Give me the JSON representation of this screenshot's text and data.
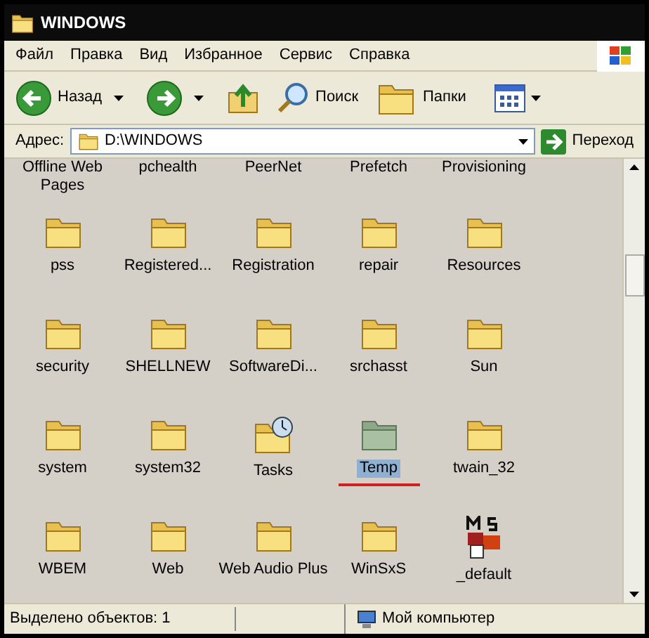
{
  "window": {
    "title": "WINDOWS"
  },
  "menu": [
    "Файл",
    "Правка",
    "Вид",
    "Избранное",
    "Сервис",
    "Справка"
  ],
  "toolbar": {
    "back": "Назад",
    "search": "Поиск",
    "folders": "Папки"
  },
  "address": {
    "label": "Адрес:",
    "value": "D:\\WINDOWS",
    "go": "Переход"
  },
  "top_labels": [
    "Offline Web Pages",
    "pchealth",
    "PeerNet",
    "Prefetch",
    "Provisioning"
  ],
  "items": [
    {
      "name": "pss",
      "kind": "folder",
      "selected": false,
      "annotated": false
    },
    {
      "name": "Registered...",
      "kind": "folder",
      "selected": false,
      "annotated": false
    },
    {
      "name": "Registration",
      "kind": "folder",
      "selected": false,
      "annotated": false
    },
    {
      "name": "repair",
      "kind": "folder",
      "selected": false,
      "annotated": false
    },
    {
      "name": "Resources",
      "kind": "folder",
      "selected": false,
      "annotated": false
    },
    {
      "name": "security",
      "kind": "folder",
      "selected": false,
      "annotated": false
    },
    {
      "name": "SHELLNEW",
      "kind": "folder",
      "selected": false,
      "annotated": false
    },
    {
      "name": "SoftwareDi...",
      "kind": "folder",
      "selected": false,
      "annotated": false
    },
    {
      "name": "srchasst",
      "kind": "folder",
      "selected": false,
      "annotated": false
    },
    {
      "name": "Sun",
      "kind": "folder",
      "selected": false,
      "annotated": false
    },
    {
      "name": "system",
      "kind": "folder",
      "selected": false,
      "annotated": false
    },
    {
      "name": "system32",
      "kind": "folder",
      "selected": false,
      "annotated": false
    },
    {
      "name": "Tasks",
      "kind": "tasks",
      "selected": false,
      "annotated": false
    },
    {
      "name": "Temp",
      "kind": "folder",
      "selected": true,
      "annotated": true
    },
    {
      "name": "twain_32",
      "kind": "folder",
      "selected": false,
      "annotated": false
    },
    {
      "name": "WBEM",
      "kind": "folder",
      "selected": false,
      "annotated": false
    },
    {
      "name": "Web",
      "kind": "folder",
      "selected": false,
      "annotated": false
    },
    {
      "name": "Web Audio Plus",
      "kind": "folder",
      "selected": false,
      "annotated": false
    },
    {
      "name": "WinSxS",
      "kind": "folder",
      "selected": false,
      "annotated": false
    },
    {
      "name": "_default",
      "kind": "app",
      "selected": false,
      "annotated": false
    }
  ],
  "status_bar": {
    "selection": "Выделено объектов: 1",
    "location": "Мой компьютер"
  }
}
